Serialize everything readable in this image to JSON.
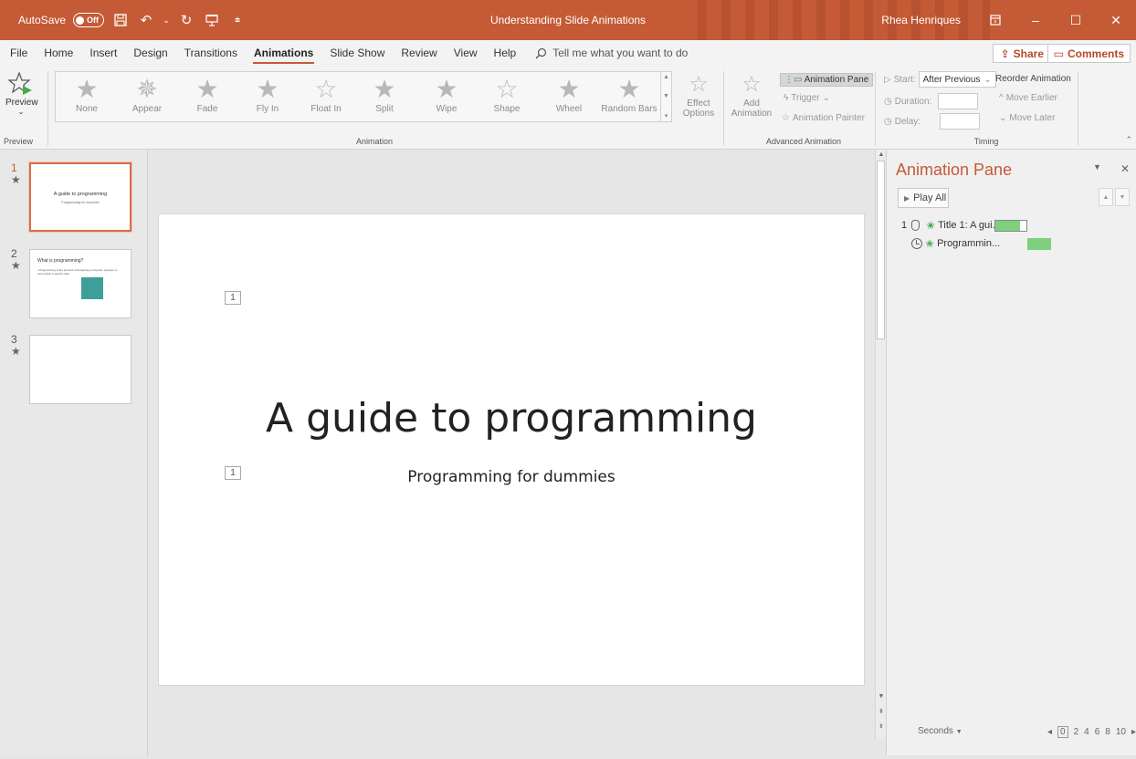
{
  "titlebar": {
    "autosave_label": "AutoSave",
    "autosave_state": "Off",
    "document_title": "Understanding Slide Animations",
    "user_name": "Rhea Henriques",
    "accent_color": "#c55a36"
  },
  "tabs": [
    "File",
    "Home",
    "Insert",
    "Design",
    "Transitions",
    "Animations",
    "Slide Show",
    "Review",
    "View",
    "Help"
  ],
  "active_tab": "Animations",
  "tell_me": "Tell me what you want to do",
  "share_label": "Share",
  "comments_label": "Comments",
  "ribbon": {
    "preview": {
      "button": "Preview",
      "group": "Preview"
    },
    "animation_group": "Animation",
    "gallery": [
      "None",
      "Appear",
      "Fade",
      "Fly In",
      "Float In",
      "Split",
      "Wipe",
      "Shape",
      "Wheel",
      "Random Bars"
    ],
    "effect_options": [
      "Effect",
      "Options"
    ],
    "advanced": {
      "add_animation": [
        "Add",
        "Animation"
      ],
      "animation_pane": "Animation Pane",
      "trigger": "Trigger",
      "animation_painter": "Animation Painter",
      "group": "Advanced Animation"
    },
    "timing": {
      "start_label": "Start:",
      "start_value": "After Previous",
      "duration_label": "Duration:",
      "delay_label": "Delay:",
      "reorder": "Reorder Animation",
      "move_earlier": "Move Earlier",
      "move_later": "Move Later",
      "group": "Timing"
    }
  },
  "slides": [
    {
      "number": "1",
      "title": "A guide to programming",
      "subtitle": "Programming for dummies"
    },
    {
      "number": "2",
      "title": "What is programming?",
      "body": "• Programming is the process of designing a computer program to accomplish a specific task"
    },
    {
      "number": "3"
    }
  ],
  "slide_star": "★",
  "current_slide": {
    "title": "A guide to programming",
    "subtitle": "Programming for dummies",
    "tag1": "1",
    "tag2": "1"
  },
  "animation_pane": {
    "title": "Animation Pane",
    "play_all": "Play All",
    "items": [
      {
        "index": "1",
        "label": "Title 1: A gui...",
        "bar_start": 0.0,
        "bar_fill": 0.8
      },
      {
        "index": "",
        "label": "Programmin...",
        "bar_start": 1.0,
        "bar_fill": 1.0
      }
    ],
    "timeline_unit": "Seconds",
    "timeline_ticks": [
      "0",
      "2",
      "4",
      "6",
      "8",
      "10"
    ]
  }
}
